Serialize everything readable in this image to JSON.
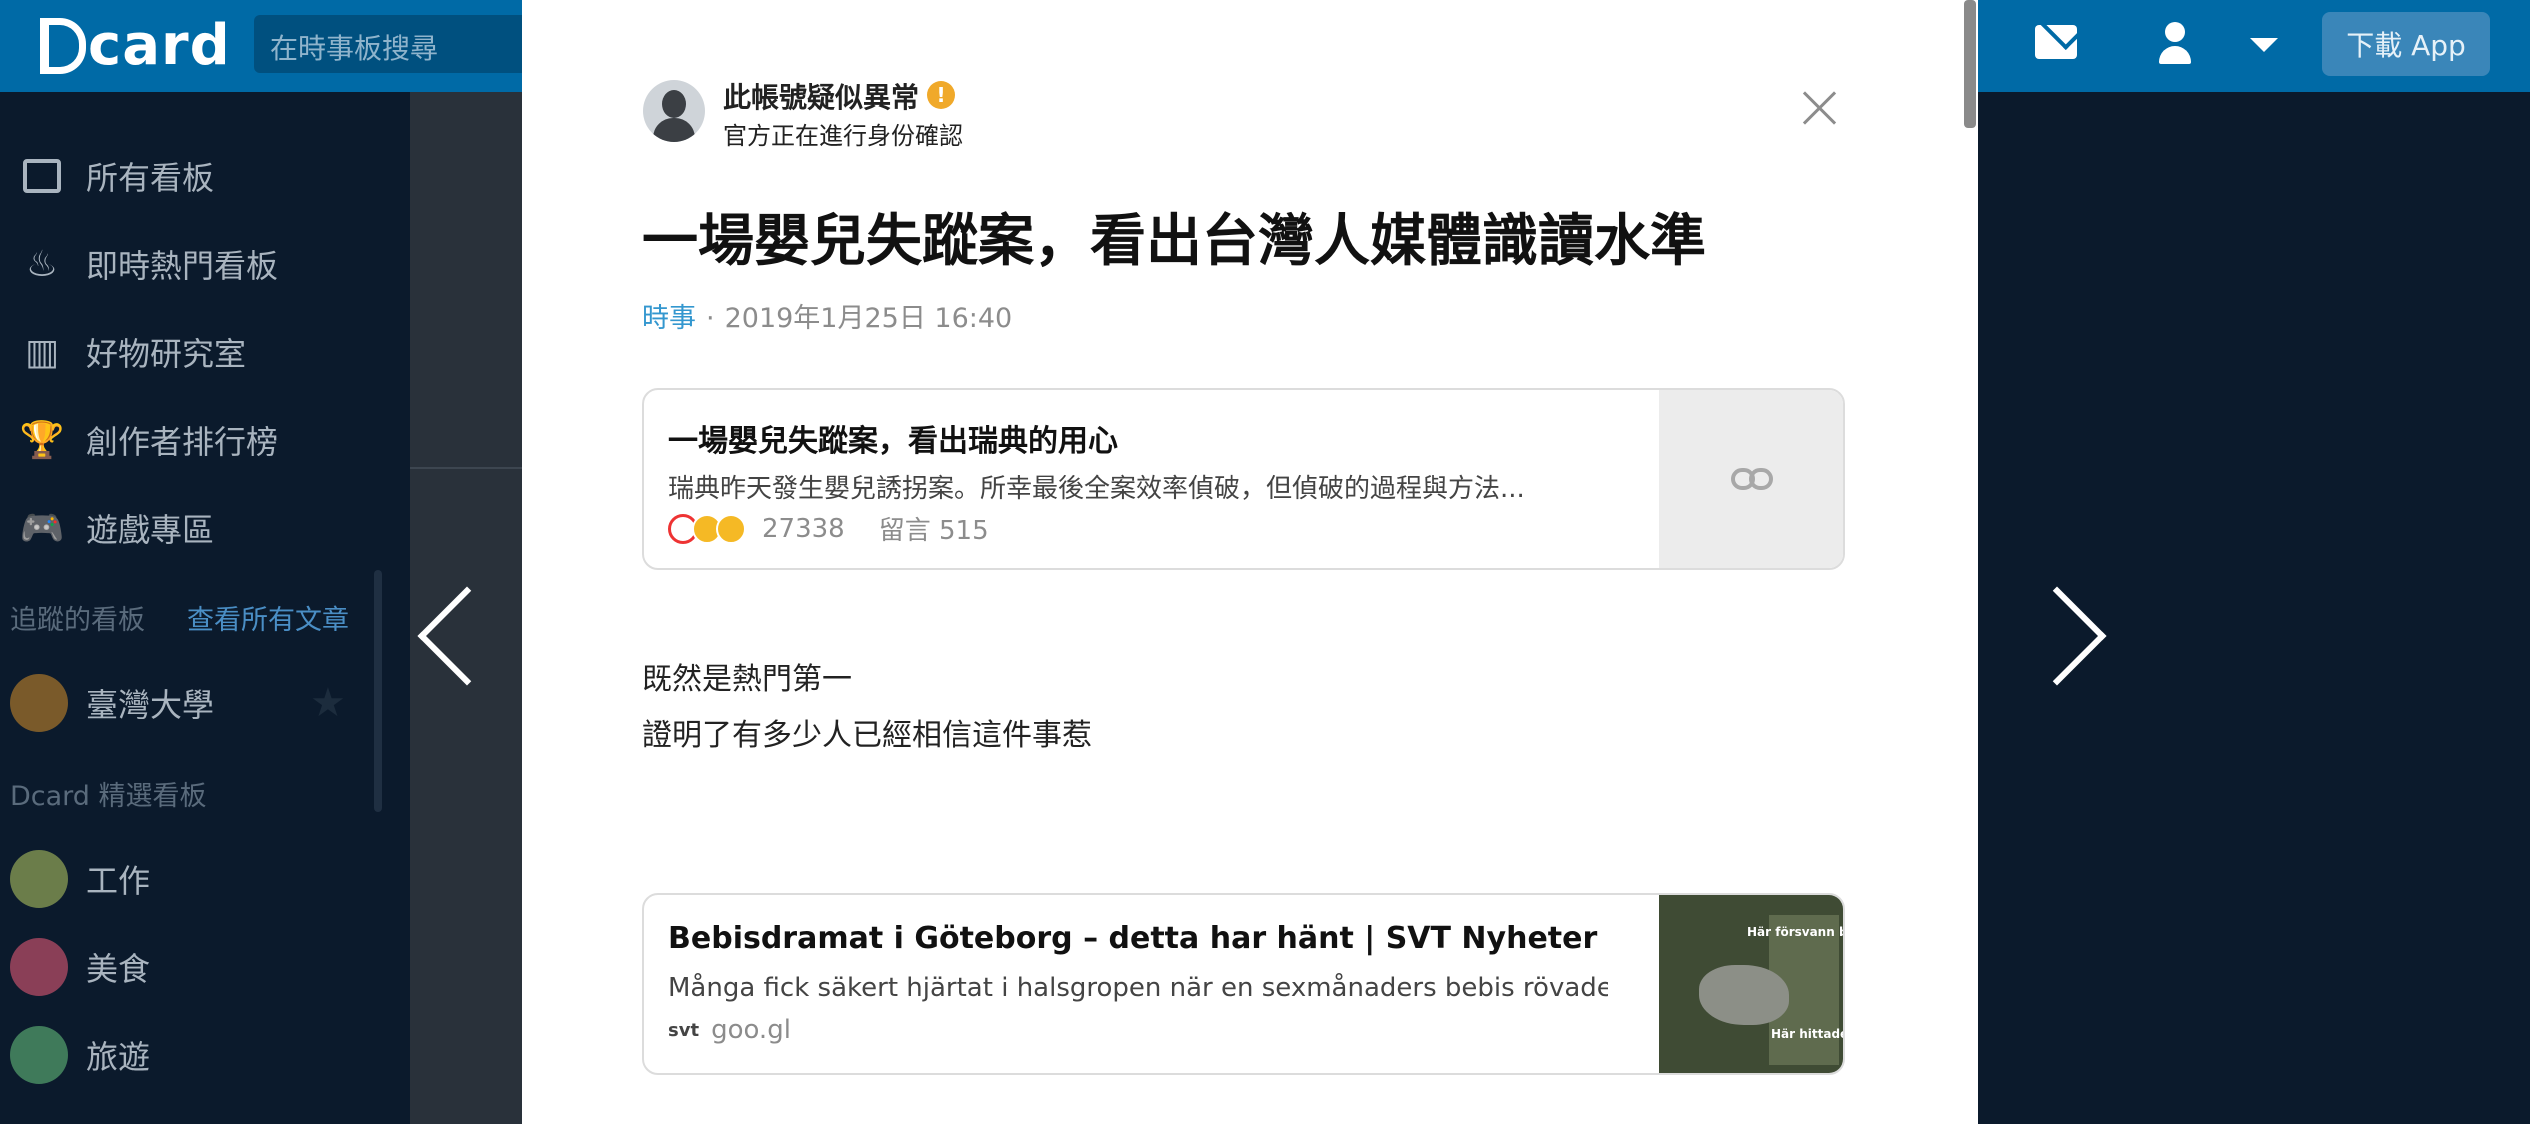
{
  "header": {
    "logo_text": "card",
    "search_placeholder": "在時事板搜尋",
    "download_label": "下載 App"
  },
  "sidebar": {
    "items": [
      {
        "label": "所有看板",
        "icon": "board-list-icon"
      },
      {
        "label": "即時熱門看板",
        "icon": "fire-icon"
      },
      {
        "label": "好物研究室",
        "icon": "store-icon"
      },
      {
        "label": "創作者排行榜",
        "icon": "trophy-icon"
      },
      {
        "label": "遊戲專區",
        "icon": "gamepad-icon"
      }
    ],
    "following_heading": "追蹤的看板",
    "view_all_link": "查看所有文章",
    "followed": [
      {
        "label": "臺灣大學"
      }
    ],
    "featured_heading": "Dcard 精選看板",
    "featured": [
      {
        "label": "工作"
      },
      {
        "label": "美食"
      },
      {
        "label": "旅遊"
      }
    ]
  },
  "post": {
    "author_name": "此帳號疑似異常",
    "author_status": "官方正在進行身份確認",
    "title": "一場嬰兒失蹤案，看出台灣人媒體識讀水準",
    "forum": "時事",
    "separator": "·",
    "datetime": "2019年1月25日 16:40",
    "link_card": {
      "title": "一場嬰兒失蹤案，看出瑞典的用心",
      "description": "瑞典昨天發生嬰兒誘拐案。所幸最後全案效率偵破，但偵破的過程與方法...",
      "reaction_count": "27338",
      "comments": "留言 515"
    },
    "body_lines": [
      "既然是熱門第一",
      "證明了有多少人已經相信這件事惹"
    ],
    "external_card": {
      "title": "Bebisdramat i Göteborg – detta har hänt | SVT Nyheter",
      "description": "Många fick säkert hjärtat i halsgropen när en sexmånaders bebis rövades ...",
      "source_icon": "svt",
      "domain": "goo.gl",
      "map_label_1": "Här försvann b",
      "map_label_2": "Här hittade"
    }
  },
  "colors": {
    "brand": "#006aa6",
    "forum_link": "#3397cf",
    "warning": "#f0a92a"
  }
}
